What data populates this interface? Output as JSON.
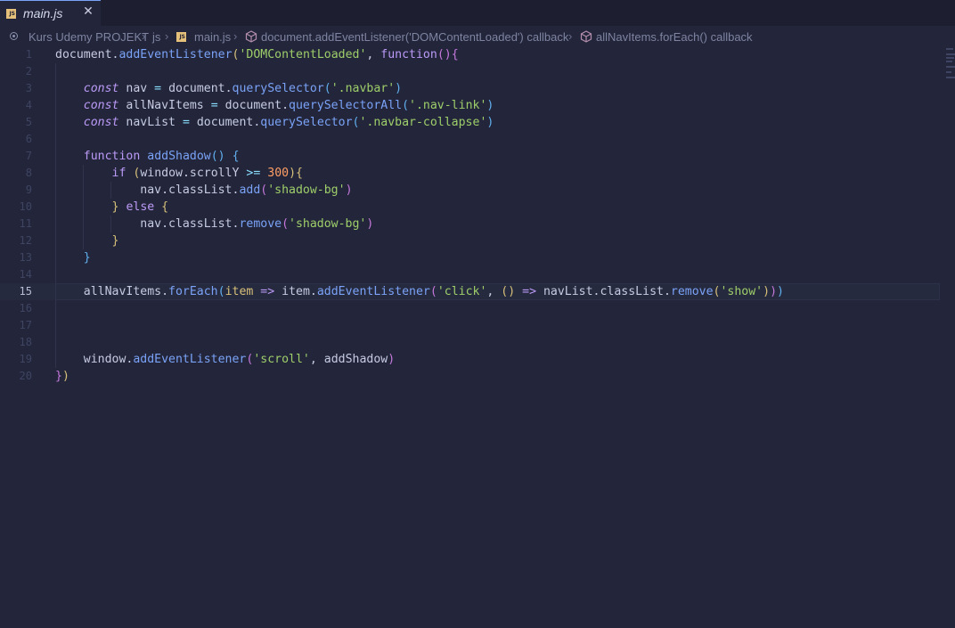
{
  "tab": {
    "filename": "main.js",
    "icon": "js-file-icon",
    "close_icon": "✕"
  },
  "breadcrumb": [
    {
      "label": "Kurs Udemy PROJEKT",
      "icon": "project-root-icon"
    },
    {
      "label": "js"
    },
    {
      "label": "main.js",
      "icon": "js-file-icon"
    },
    {
      "label": "document.addEventListener('DOMContentLoaded') callback",
      "icon": "method-cube-icon"
    },
    {
      "label": "allNavItems.forEach() callback",
      "icon": "method-cube-icon"
    }
  ],
  "editor": {
    "current_line": 15,
    "lines": [
      {
        "n": "1",
        "tokens": [
          [
            "var",
            "document"
          ],
          [
            "var",
            "."
          ],
          [
            "fn",
            "addEventListener"
          ],
          [
            "pr",
            "("
          ],
          [
            "str",
            "'DOMContentLoaded'"
          ],
          [
            "var",
            ", "
          ],
          [
            "kw",
            "function"
          ],
          [
            "pu",
            "()"
          ],
          [
            "pu",
            "{"
          ]
        ]
      },
      {
        "n": "2",
        "tokens": []
      },
      {
        "n": "3",
        "tokens": [
          [
            "var",
            "    "
          ],
          [
            "kwi",
            "const"
          ],
          [
            "var",
            " nav "
          ],
          [
            "op",
            "="
          ],
          [
            "var",
            " document."
          ],
          [
            "fn",
            "querySelector"
          ],
          [
            "pb",
            "("
          ],
          [
            "str",
            "'.navbar'"
          ],
          [
            "pb",
            ")"
          ]
        ]
      },
      {
        "n": "4",
        "tokens": [
          [
            "var",
            "    "
          ],
          [
            "kwi",
            "const"
          ],
          [
            "var",
            " allNavItems "
          ],
          [
            "op",
            "="
          ],
          [
            "var",
            " document."
          ],
          [
            "fn",
            "querySelectorAll"
          ],
          [
            "pb",
            "("
          ],
          [
            "str",
            "'.nav-link'"
          ],
          [
            "pb",
            ")"
          ]
        ]
      },
      {
        "n": "5",
        "tokens": [
          [
            "var",
            "    "
          ],
          [
            "kwi",
            "const"
          ],
          [
            "var",
            " navList "
          ],
          [
            "op",
            "="
          ],
          [
            "var",
            " document."
          ],
          [
            "fn",
            "querySelector"
          ],
          [
            "pb",
            "("
          ],
          [
            "str",
            "'.navbar-collapse'"
          ],
          [
            "pb",
            ")"
          ]
        ]
      },
      {
        "n": "6",
        "tokens": []
      },
      {
        "n": "7",
        "tokens": [
          [
            "var",
            "    "
          ],
          [
            "kw",
            "function"
          ],
          [
            "var",
            " "
          ],
          [
            "fn",
            "addShadow"
          ],
          [
            "pb",
            "()"
          ],
          [
            "var",
            " "
          ],
          [
            "pb",
            "{"
          ]
        ]
      },
      {
        "n": "8",
        "tokens": [
          [
            "var",
            "        "
          ],
          [
            "kw",
            "if"
          ],
          [
            "var",
            " "
          ],
          [
            "pr",
            "("
          ],
          [
            "var",
            "window.scrollY "
          ],
          [
            "op",
            ">="
          ],
          [
            "var",
            " "
          ],
          [
            "num",
            "300"
          ],
          [
            "pr",
            ")"
          ],
          [
            "pr",
            "{"
          ]
        ]
      },
      {
        "n": "9",
        "tokens": [
          [
            "var",
            "            nav.classList."
          ],
          [
            "fn",
            "add"
          ],
          [
            "pu",
            "("
          ],
          [
            "str",
            "'shadow-bg'"
          ],
          [
            "pu",
            ")"
          ]
        ]
      },
      {
        "n": "10",
        "tokens": [
          [
            "var",
            "        "
          ],
          [
            "pr",
            "}"
          ],
          [
            "var",
            " "
          ],
          [
            "kw",
            "else"
          ],
          [
            "var",
            " "
          ],
          [
            "pr",
            "{"
          ]
        ]
      },
      {
        "n": "11",
        "tokens": [
          [
            "var",
            "            nav.classList."
          ],
          [
            "fn",
            "remove"
          ],
          [
            "pu",
            "("
          ],
          [
            "str",
            "'shadow-bg'"
          ],
          [
            "pu",
            ")"
          ]
        ]
      },
      {
        "n": "12",
        "tokens": [
          [
            "var",
            "        "
          ],
          [
            "pr",
            "}"
          ]
        ]
      },
      {
        "n": "13",
        "tokens": [
          [
            "var",
            "    "
          ],
          [
            "pb",
            "}"
          ]
        ]
      },
      {
        "n": "14",
        "tokens": []
      },
      {
        "n": "15",
        "tokens": [
          [
            "var",
            "    allNavItems."
          ],
          [
            "fn",
            "forEach"
          ],
          [
            "pb",
            "("
          ],
          [
            "pr",
            "item"
          ],
          [
            "var",
            " "
          ],
          [
            "kw",
            "=>"
          ],
          [
            "var",
            " item."
          ],
          [
            "fn",
            "addEventListener"
          ],
          [
            "pu",
            "("
          ],
          [
            "str",
            "'click'"
          ],
          [
            "var",
            ", "
          ],
          [
            "pr",
            "()"
          ],
          [
            "var",
            " "
          ],
          [
            "kw",
            "=>"
          ],
          [
            "var",
            " navList.classList."
          ],
          [
            "fn",
            "remove"
          ],
          [
            "pr",
            "("
          ],
          [
            "str",
            "'show'"
          ],
          [
            "pr",
            ")"
          ],
          [
            "pu",
            ")"
          ],
          [
            "pb",
            ")"
          ]
        ]
      },
      {
        "n": "16",
        "tokens": []
      },
      {
        "n": "17",
        "tokens": []
      },
      {
        "n": "18",
        "tokens": []
      },
      {
        "n": "19",
        "tokens": [
          [
            "var",
            "    window."
          ],
          [
            "fn",
            "addEventListener"
          ],
          [
            "pu",
            "("
          ],
          [
            "str",
            "'scroll'"
          ],
          [
            "var",
            ", addShadow"
          ],
          [
            "pu",
            ")"
          ]
        ]
      },
      {
        "n": "20",
        "tokens": [
          [
            "pu",
            "}"
          ],
          [
            "pr",
            ")"
          ]
        ]
      }
    ]
  },
  "colors": {
    "background": "#23263a",
    "tabbar": "#1d1f30",
    "keyword": "#bb9af7",
    "function": "#7aa2f7",
    "string": "#9ece6a",
    "number": "#ff9e64",
    "operator": "#89ddff"
  }
}
